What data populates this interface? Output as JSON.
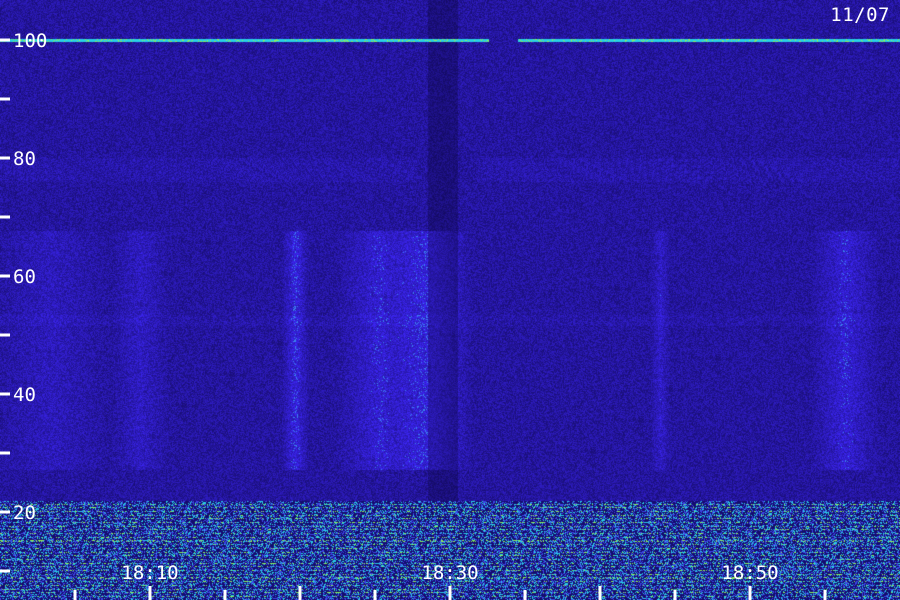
{
  "date_label": "11/07",
  "chart_data": {
    "type": "heatmap",
    "title": "",
    "xlabel": "",
    "ylabel": "",
    "y_ticks": [
      20,
      40,
      60,
      80,
      100
    ],
    "y_minor_ticks": [
      10,
      30,
      50,
      70,
      90
    ],
    "ylim": [
      0,
      105
    ],
    "x_ticks": [
      "18:10",
      "18:30",
      "18:50"
    ],
    "x_tick_minutes": [
      10,
      30,
      50
    ],
    "xlim_minutes": [
      0,
      60
    ],
    "x_minor_tick_step_minutes": 5,
    "colors": {
      "background": "#190c68",
      "noise_low": "#0a0440",
      "noise_high": "#3c2ce0",
      "signal": "#29d0e6",
      "strong_signal": "#8cf25a",
      "label": "#ffffff"
    },
    "features": {
      "persistent_carrier_y": 100,
      "weak_band_y": 78,
      "noise_floor_top_y": 22,
      "quiet_gap_minutes": [
        28.5,
        30.5
      ]
    }
  }
}
